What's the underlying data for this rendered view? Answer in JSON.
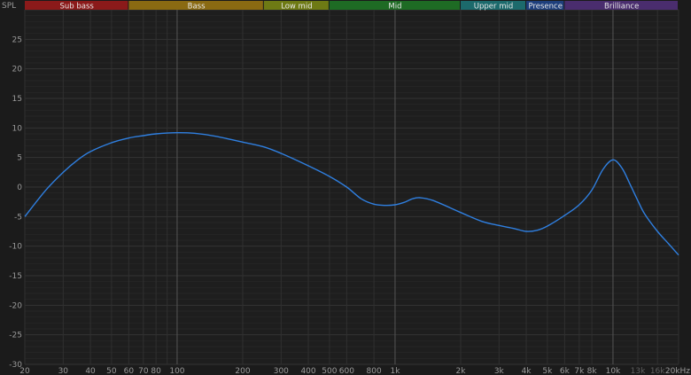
{
  "chart_data": {
    "type": "line",
    "ylabel": "SPL",
    "xscale": "log",
    "xlim": [
      20,
      20000
    ],
    "ylim": [
      -30,
      30
    ],
    "grid": true,
    "y_ticks": [
      25,
      20,
      15,
      10,
      5,
      0,
      -5,
      -10,
      -15,
      -20,
      -25,
      -30
    ],
    "x_ticks": [
      {
        "value": 20,
        "label": "20",
        "major": false
      },
      {
        "value": 30,
        "label": "30",
        "major": false
      },
      {
        "value": 40,
        "label": "40",
        "major": false
      },
      {
        "value": 50,
        "label": "50",
        "major": false
      },
      {
        "value": 60,
        "label": "60",
        "major": false
      },
      {
        "value": 70,
        "label": "70",
        "major": false
      },
      {
        "value": 80,
        "label": "80",
        "major": false
      },
      {
        "value": 90,
        "label": "",
        "major": false
      },
      {
        "value": 100,
        "label": "100",
        "major": true
      },
      {
        "value": 200,
        "label": "200",
        "major": false
      },
      {
        "value": 300,
        "label": "300",
        "major": false
      },
      {
        "value": 400,
        "label": "400",
        "major": false
      },
      {
        "value": 500,
        "label": "500",
        "major": false
      },
      {
        "value": 600,
        "label": "600",
        "major": false
      },
      {
        "value": 800,
        "label": "800",
        "major": false
      },
      {
        "value": 1000,
        "label": "1k",
        "major": true
      },
      {
        "value": 2000,
        "label": "2k",
        "major": false
      },
      {
        "value": 3000,
        "label": "3k",
        "major": false
      },
      {
        "value": 4000,
        "label": "4k",
        "major": false
      },
      {
        "value": 5000,
        "label": "5k",
        "major": false
      },
      {
        "value": 6000,
        "label": "6k",
        "major": false
      },
      {
        "value": 7000,
        "label": "7k",
        "major": false
      },
      {
        "value": 8000,
        "label": "8k",
        "major": false
      },
      {
        "value": 10000,
        "label": "10k",
        "major": true
      },
      {
        "value": 13000,
        "label": "13k",
        "major": false,
        "dim": true
      },
      {
        "value": 16000,
        "label": "16k",
        "major": false,
        "dim": true
      },
      {
        "value": 20000,
        "label": "20kHz",
        "major": false
      }
    ],
    "bands": [
      {
        "label": "Sub bass",
        "from": 20,
        "to": 60,
        "color": "#8b1a1a"
      },
      {
        "label": "Bass",
        "from": 60,
        "to": 250,
        "color": "#8a6a12"
      },
      {
        "label": "Low mid",
        "from": 250,
        "to": 500,
        "color": "#6e7a14"
      },
      {
        "label": "Mid",
        "from": 500,
        "to": 2000,
        "color": "#1e6b24"
      },
      {
        "label": "Upper mid",
        "from": 2000,
        "to": 4000,
        "color": "#1c6a6c"
      },
      {
        "label": "Presence",
        "from": 4000,
        "to": 6000,
        "color": "#1e3f7c"
      },
      {
        "label": "Brilliance",
        "from": 6000,
        "to": 20000,
        "color": "#4a2d6e"
      }
    ],
    "series": [
      {
        "color": "#2f7fe0",
        "points": [
          [
            20,
            -5.0
          ],
          [
            25,
            -0.5
          ],
          [
            30,
            2.5
          ],
          [
            35,
            4.6
          ],
          [
            40,
            6.0
          ],
          [
            50,
            7.5
          ],
          [
            60,
            8.3
          ],
          [
            70,
            8.7
          ],
          [
            80,
            9.0
          ],
          [
            100,
            9.2
          ],
          [
            120,
            9.1
          ],
          [
            150,
            8.6
          ],
          [
            200,
            7.6
          ],
          [
            250,
            6.8
          ],
          [
            300,
            5.7
          ],
          [
            400,
            3.6
          ],
          [
            500,
            1.8
          ],
          [
            600,
            0.0
          ],
          [
            700,
            -2.0
          ],
          [
            800,
            -2.9
          ],
          [
            900,
            -3.1
          ],
          [
            1000,
            -3.0
          ],
          [
            1100,
            -2.6
          ],
          [
            1200,
            -2.0
          ],
          [
            1300,
            -1.8
          ],
          [
            1500,
            -2.3
          ],
          [
            2000,
            -4.3
          ],
          [
            2500,
            -5.8
          ],
          [
            3000,
            -6.5
          ],
          [
            3500,
            -7.0
          ],
          [
            4000,
            -7.5
          ],
          [
            4500,
            -7.3
          ],
          [
            5000,
            -6.6
          ],
          [
            6000,
            -4.8
          ],
          [
            7000,
            -3.0
          ],
          [
            8000,
            -0.5
          ],
          [
            9000,
            3.0
          ],
          [
            10000,
            4.6
          ],
          [
            11000,
            3.2
          ],
          [
            12000,
            0.4
          ],
          [
            13000,
            -2.3
          ],
          [
            14000,
            -4.6
          ],
          [
            16000,
            -7.5
          ],
          [
            18000,
            -9.6
          ],
          [
            20000,
            -11.5
          ]
        ]
      }
    ]
  }
}
